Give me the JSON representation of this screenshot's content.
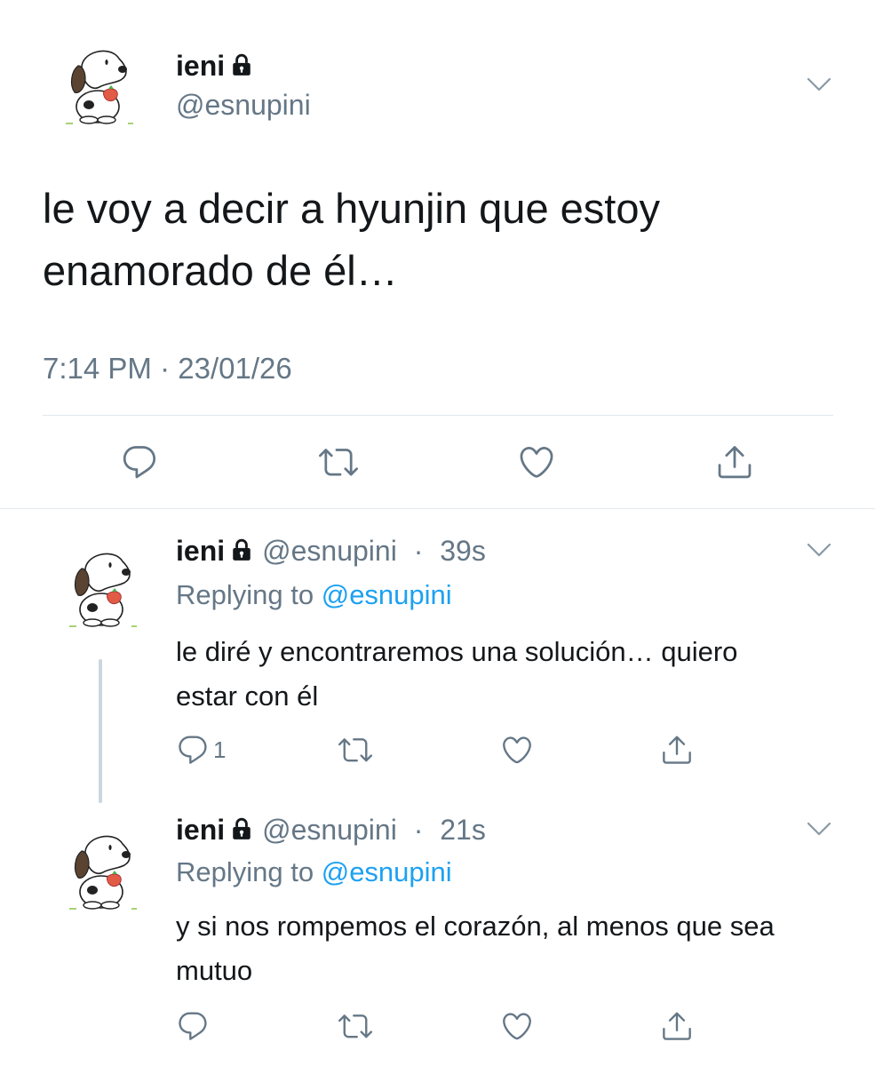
{
  "main_tweet": {
    "display_name": "ieni",
    "handle": "@esnupini",
    "text": "le voy a decir a hyunjin que estoy enamorado de él…",
    "time": "7:14 PM",
    "date": "23/01/26",
    "time_sep": " · "
  },
  "replies": [
    {
      "display_name": "ieni",
      "handle": "@esnupini",
      "time_ago": "39s",
      "replying_prefix": "Replying to ",
      "replying_to": "@esnupini",
      "text": "le diré y encontraremos una solución… quiero estar con él",
      "reply_count": "1"
    },
    {
      "display_name": "ieni",
      "handle": "@esnupini",
      "time_ago": "21s",
      "replying_prefix": "Replying to ",
      "replying_to": "@esnupini",
      "text": "y si nos rompemos el corazón, al menos que sea mutuo",
      "reply_count": ""
    }
  ],
  "colors": {
    "text": "#14171a",
    "secondary": "#657786",
    "link": "#1da1f2",
    "divider": "#e1e8ed",
    "icon": "#657786"
  },
  "icons": {
    "avatar": "snoopy-avatar",
    "lock": "lock-icon",
    "more": "chevron-down-icon",
    "reply": "reply-icon",
    "retweet": "retweet-icon",
    "like": "heart-icon",
    "share": "share-icon"
  }
}
